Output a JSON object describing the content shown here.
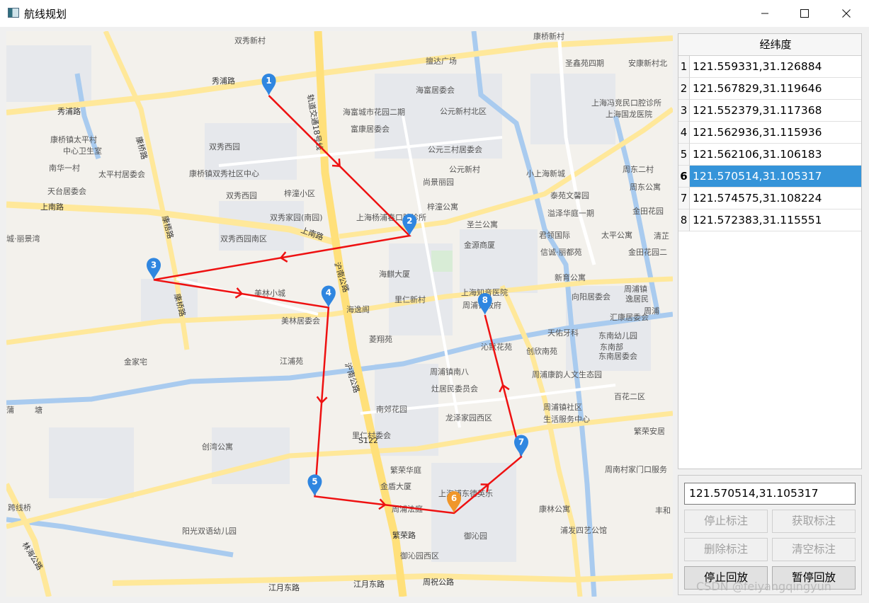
{
  "window": {
    "title": "航线规划"
  },
  "map": {
    "roads": [
      {
        "name": "秀浦路"
      },
      {
        "name": "秀浦路"
      },
      {
        "name": "上南路"
      },
      {
        "name": "上南路"
      },
      {
        "name": "沪南公路"
      },
      {
        "name": "沪南公路"
      },
      {
        "name": "康桥路"
      },
      {
        "name": "康梧路"
      },
      {
        "name": "康桥路"
      },
      {
        "name": "繁荣路"
      },
      {
        "name": "江月东路"
      },
      {
        "name": "江月东路"
      },
      {
        "name": "周祝公路"
      },
      {
        "name": "林海公路"
      },
      {
        "name": "轨道交通18号线"
      },
      {
        "name": "S122"
      }
    ],
    "places": [
      "双秀新村",
      "擅达广场",
      "海富居委会",
      "海富城市花园二期",
      "公元新村北区",
      "富康居委会",
      "公元三村居委会",
      "公元新村",
      "尚景丽园",
      "小上海新城",
      "康桥镇太平村",
      "中心卫生室",
      "南华一村",
      "太平村居委会",
      "康桥镇双秀社区中心",
      "天台居委会",
      "双秀西园",
      "双秀西园",
      "梓潼小区",
      "双秀家园(南园)",
      "双秀西园南区",
      "城·丽景湾",
      "上海杨浦春口腔诊所",
      "梓潼公寓",
      "圣兰公寓",
      "金源商厦",
      "君领国际",
      "信诚·丽都苑",
      "溢泽华庭一期",
      "泰苑文馨园",
      "美林小城",
      "美林居委会",
      "海麒大厦",
      "海逸阁",
      "里仁新村",
      "上海知音医院",
      "周浦镇政府",
      "新育公寓",
      "向阳居委会",
      "汇康居委会",
      "天佑牙科",
      "东南幼儿园",
      "东南部",
      "东南居委会",
      "菱翔苑",
      "江浦苑",
      "金家宅",
      "沁默花苑",
      "创欣南苑",
      "周浦康韵人文生态园",
      "周浦镇南八",
      "灶居民委员会",
      "南郊花园",
      "龙泽家园西区",
      "周浦镇社区",
      "生活服务中心",
      "百花二区",
      "繁荣安居",
      "周南村家门口服务",
      "里仁村委会",
      "创湾公寓",
      "繁荣华庭",
      "金盾大厦",
      "上海浦东德英乐",
      "周浦法庭",
      "御沁园",
      "康林公寓",
      "浦发四艺公馆",
      "阳光双语幼儿园",
      "御沁园西区",
      "跨线桥",
      "圣鑫苑四期",
      "安康新村北",
      "上海冯竞民口腔诊所",
      "上海国龙医院",
      "周东二村",
      "周东公寓",
      "金田花园",
      "太平公寓",
      "金田花园二",
      "清芷",
      "周浦镇",
      "逸居民",
      "周浦",
      "丰和",
      "蒲",
      "塘",
      "康桥新村"
    ],
    "markers": [
      {
        "label": "1",
        "lng": 121.559331,
        "lat": 31.126884,
        "color": "#2f86e0"
      },
      {
        "label": "2",
        "lng": 121.567829,
        "lat": 31.119646,
        "color": "#2f86e0"
      },
      {
        "label": "3",
        "lng": 121.552379,
        "lat": 31.117368,
        "color": "#2f86e0"
      },
      {
        "label": "4",
        "lng": 121.562936,
        "lat": 31.115936,
        "color": "#2f86e0"
      },
      {
        "label": "5",
        "lng": 121.562106,
        "lat": 31.106183,
        "color": "#2f86e0"
      },
      {
        "label": "6",
        "lng": 121.570514,
        "lat": 31.105317,
        "color": "#f0962a"
      },
      {
        "label": "7",
        "lng": 121.574575,
        "lat": 31.108224,
        "color": "#2f86e0"
      },
      {
        "label": "8",
        "lng": 121.572383,
        "lat": 31.115551,
        "color": "#2f86e0"
      }
    ],
    "route_color": "#ee1111"
  },
  "table": {
    "header": "经纬度",
    "rows": [
      {
        "index": "1",
        "value": "121.559331,31.126884"
      },
      {
        "index": "2",
        "value": "121.567829,31.119646"
      },
      {
        "index": "3",
        "value": "121.552379,31.117368"
      },
      {
        "index": "4",
        "value": "121.562936,31.115936"
      },
      {
        "index": "5",
        "value": "121.562106,31.106183"
      },
      {
        "index": "6",
        "value": "121.570514,31.105317"
      },
      {
        "index": "7",
        "value": "121.574575,31.108224"
      },
      {
        "index": "8",
        "value": "121.572383,31.115551"
      }
    ],
    "selected_index": 6,
    "selected_color": "#3594d9"
  },
  "controls": {
    "coord_value": "121.570514,31.105317",
    "stop_mark": "停止标注",
    "get_mark": "获取标注",
    "delete_mark": "删除标注",
    "clear_mark": "清空标注",
    "stop_replay": "停止回放",
    "pause_replay": "暂停回放"
  },
  "watermark": "CSDN @feiyangqingyun"
}
